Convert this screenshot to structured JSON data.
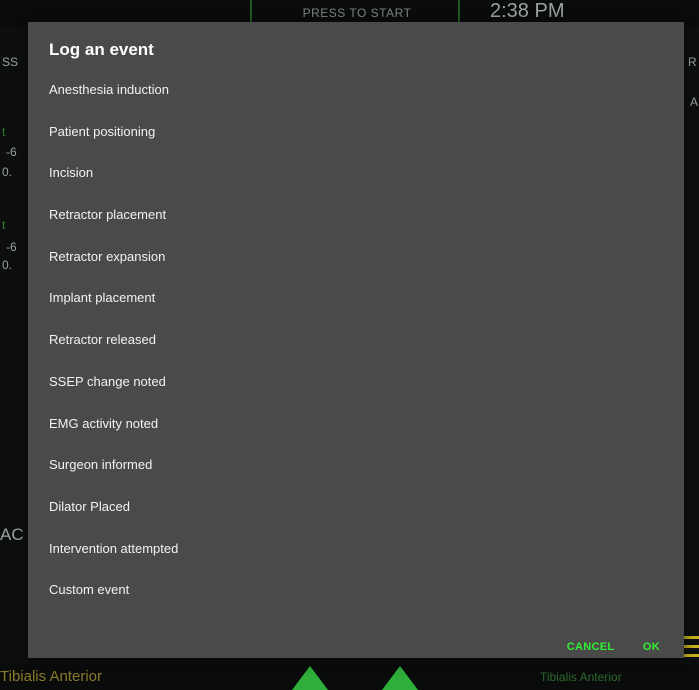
{
  "background": {
    "press_to_start": "PRESS TO START",
    "time": "2:38 PM",
    "bottom_left_label": "Tibialis Anterior",
    "bottom_right_label": "Tibialis Anterior"
  },
  "dialog": {
    "title": "Log an event",
    "events": [
      "Anesthesia induction",
      "Patient positioning",
      "Incision",
      "Retractor placement",
      "Retractor expansion",
      "Implant placement",
      "Retractor released",
      "SSEP change noted",
      "EMG activity noted",
      "Surgeon informed",
      "Dilator Placed",
      "Intervention attempted",
      "Custom event"
    ],
    "cancel_label": "CANCEL",
    "ok_label": "OK"
  },
  "colors": {
    "dialog_bg": "#4a4a4a",
    "accent_green": "#33ee33",
    "app_bg": "#0d0f0e"
  }
}
